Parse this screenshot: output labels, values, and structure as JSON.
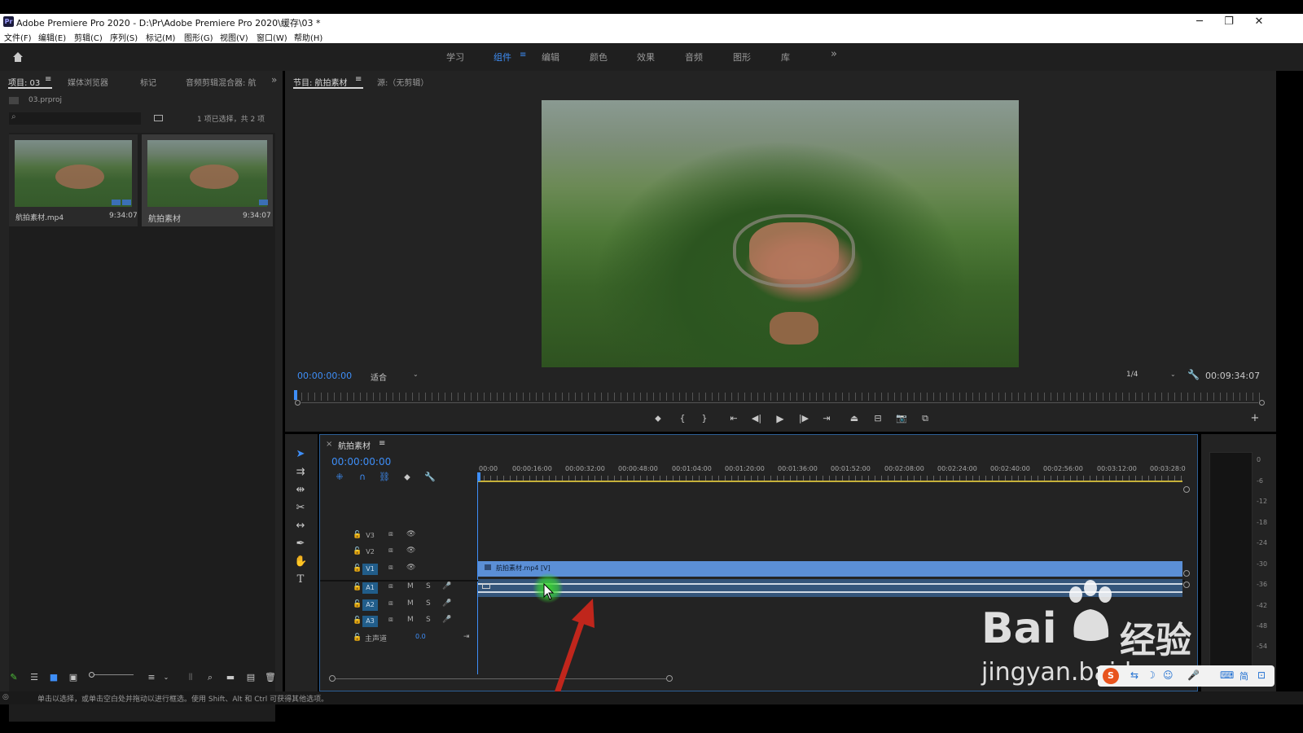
{
  "window": {
    "title": "Adobe Premiere Pro 2020 - D:\\Pr\\Adobe Premiere Pro 2020\\缓存\\03 *",
    "app_badge": "Pr",
    "minimize": "─",
    "maximize": "❐",
    "close": "✕"
  },
  "menu": [
    "文件(F)",
    "编辑(E)",
    "剪辑(C)",
    "序列(S)",
    "标记(M)",
    "图形(G)",
    "视图(V)",
    "窗口(W)",
    "帮助(H)"
  ],
  "workspaces": {
    "tabs": [
      "学习",
      "组件",
      "编辑",
      "颜色",
      "效果",
      "音频",
      "图形",
      "库"
    ],
    "active": "组件",
    "more": "»"
  },
  "project_panel": {
    "tabs": [
      "项目: 03",
      "媒体浏览器",
      "标记",
      "音频剪辑混合器: 航"
    ],
    "overflow": "»",
    "file_name": "03.prproj",
    "selection_info": "1 项已选择，共 2 项",
    "items": [
      {
        "name": "航拍素材.mp4",
        "duration": "9:34:07"
      },
      {
        "name": "航拍素材",
        "duration": "9:34:07"
      }
    ]
  },
  "program_monitor": {
    "tabs": [
      "节目: 航拍素材",
      "源:（无剪辑）"
    ],
    "current_time": "00:00:00:00",
    "fit": "适合",
    "resolution": "1/4",
    "duration": "00:09:34:07"
  },
  "timeline": {
    "sequence_name": "航拍素材",
    "current_time": "00:00:00:00",
    "ruler": [
      "00:00",
      "00:00:16:00",
      "00:00:32:00",
      "00:00:48:00",
      "00:01:04:00",
      "00:01:20:00",
      "00:01:36:00",
      "00:01:52:00",
      "00:02:08:00",
      "00:02:24:00",
      "00:02:40:00",
      "00:02:56:00",
      "00:03:12:00",
      "00:03:28:0"
    ],
    "video_tracks": [
      "V3",
      "V2",
      "V1"
    ],
    "audio_tracks": [
      "A1",
      "A2",
      "A3"
    ],
    "master_label": "主声道",
    "master_value": "0.0",
    "mute_label": "M",
    "solo_label": "S",
    "clip_label": "航拍素材.mp4 [V]"
  },
  "audio_meter": {
    "scale": [
      "0",
      "-6",
      "-12",
      "-18",
      "-24",
      "-30",
      "-36",
      "-42",
      "-48",
      "-54"
    ]
  },
  "status_bar": {
    "hint": "单击以选择，或单击空白处并拖动以进行框选。使用 Shift、Alt 和 Ctrl 可获得其他选项。"
  },
  "watermark": {
    "brand": "Bai",
    "brand_cn": "经验",
    "url": "jingyan.baidu.com",
    "ime_label": "简"
  },
  "colors": {
    "accent_blue": "#3e8ef7",
    "clip_video": "#5b8fd6",
    "track_active": "#215d8a",
    "annotation_arrow": "#c0261c",
    "cursor_highlight": "#38d430"
  }
}
